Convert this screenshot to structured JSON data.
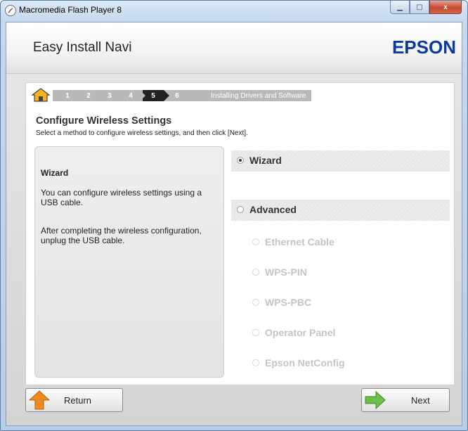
{
  "window": {
    "title": "Macromedia Flash Player 8",
    "controls": [
      "minimize",
      "maximize",
      "close"
    ],
    "close_label": "x"
  },
  "header": {
    "app_title": "Easy Install Navi",
    "brand": "EPSON"
  },
  "stepbar": {
    "steps": [
      "1",
      "2",
      "3",
      "4",
      "5",
      "6"
    ],
    "active_step": "5",
    "trailing_label": "Installing Drivers and Software"
  },
  "page": {
    "title": "Configure Wireless Settings",
    "subtitle": "Select a method to configure wireless settings, and then click [Next]."
  },
  "description": {
    "title": "Wizard",
    "paragraph1": "You can configure wireless settings using a USB cable.",
    "paragraph2": "After completing the wireless configuration, unplug the USB cable."
  },
  "options": {
    "wizard": "Wizard",
    "advanced": "Advanced",
    "ethernet": "Ethernet Cable",
    "wps_pin": "WPS-PIN",
    "wps_pbc": "WPS-PBC",
    "operator_panel": "Operator Panel",
    "netconfig": "Epson NetConfig"
  },
  "buttons": {
    "return": "Return",
    "next": "Next"
  },
  "colors": {
    "brand_blue": "#0b3aa5",
    "active_step": "#222222",
    "inactive_step": "#b9b9b9",
    "arrow_orange": "#f08a1c",
    "arrow_green": "#6cc04a"
  }
}
